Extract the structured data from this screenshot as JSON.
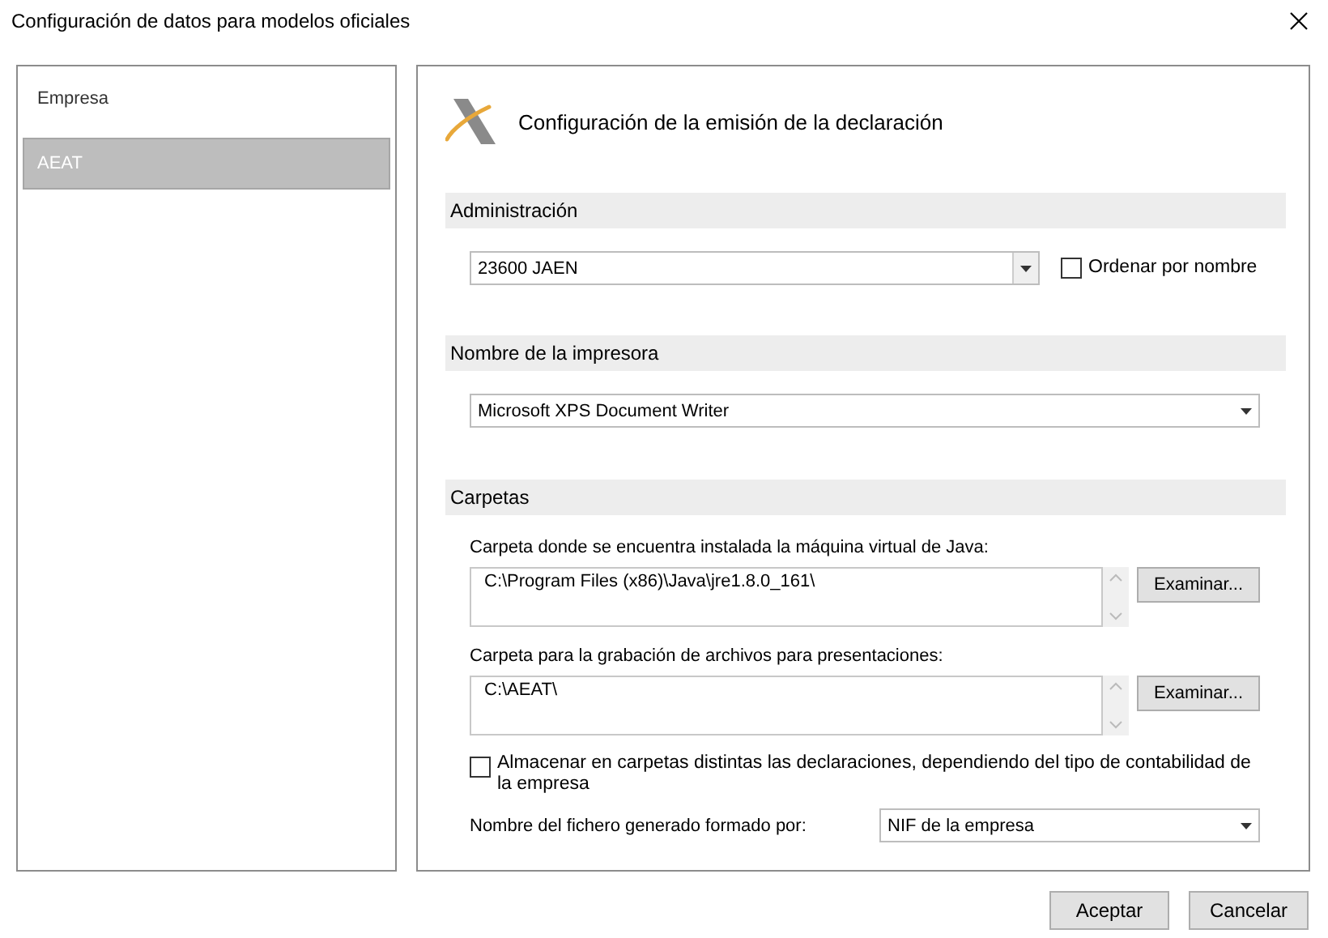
{
  "window": {
    "title": "Configuración de datos para modelos oficiales"
  },
  "sidebar": {
    "items": [
      {
        "label": "Empresa",
        "selected": false
      },
      {
        "label": "AEAT",
        "selected": true
      }
    ]
  },
  "header": {
    "title": "Configuración de la emisión de la declaración"
  },
  "administration": {
    "heading": "Administración",
    "select": "23600 JAEN",
    "sort_checkbox": {
      "label": "Ordenar por nombre",
      "checked": false
    }
  },
  "printer": {
    "heading": "Nombre de la impresora",
    "select": "Microsoft XPS Document Writer"
  },
  "folders": {
    "heading": "Carpetas",
    "fields": [
      {
        "label": "Carpeta donde se encuentra instalada la máquina virtual de Java:",
        "value": "C:\\Program Files (x86)\\Java\\jre1.8.0_161\\",
        "button": "Examinar..."
      },
      {
        "label": "Carpeta para la grabación de archivos para presentaciones:",
        "value": "C:\\AEAT\\",
        "button": "Examinar..."
      }
    ],
    "separate_checkbox": {
      "label": "Almacenar en carpetas distintas las declaraciones, dependiendo del tipo de contabilidad de la empresa",
      "checked": false
    },
    "file_name": {
      "label": "Nombre del fichero generado formado por:",
      "value": "NIF de la empresa"
    }
  },
  "buttons": [
    "Aceptar",
    "Cancelar"
  ]
}
